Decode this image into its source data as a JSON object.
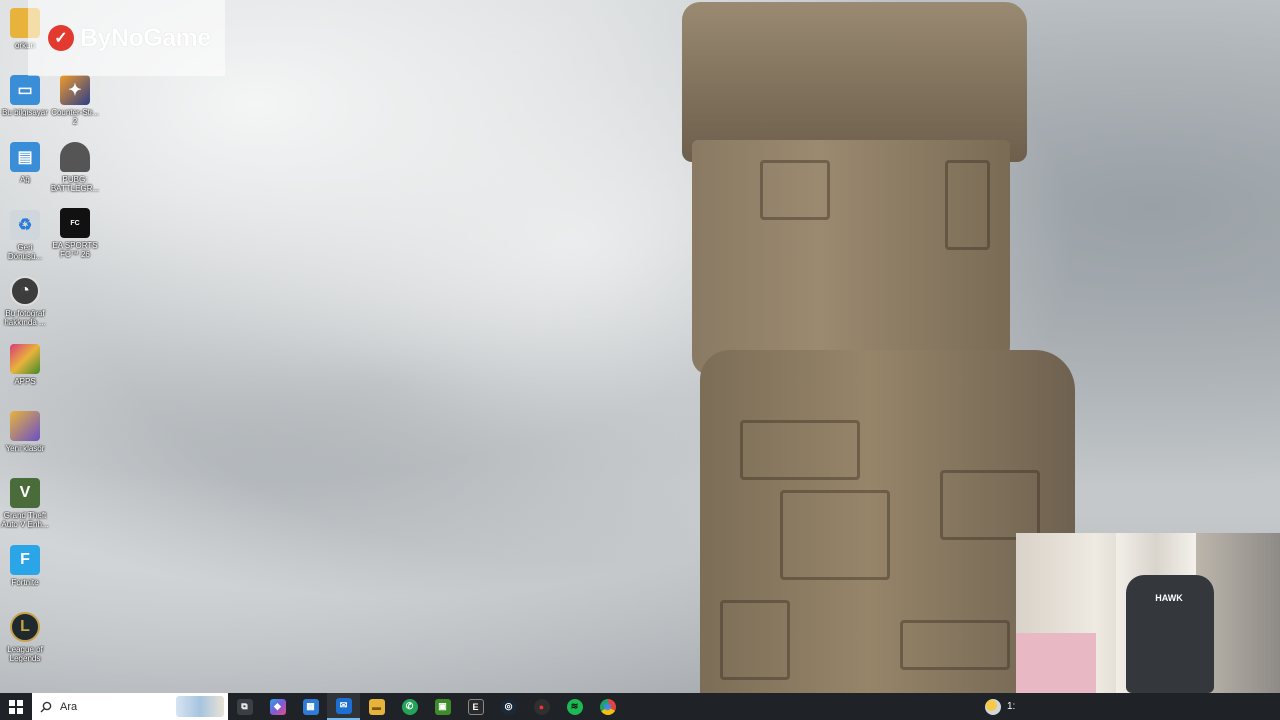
{
  "brand": {
    "logo_text": "ByNoGame",
    "logo_mark": "✓"
  },
  "desktop": {
    "icons": [
      {
        "id": "orkun",
        "label": "orkun",
        "icon": "folder-icon",
        "color": "#e8b33c"
      },
      {
        "id": "this-pc",
        "label": "Bu bilgisayar",
        "icon": "computer-icon",
        "color": "#3a8ed8"
      },
      {
        "id": "counter-strike",
        "label": "Counter-Str... 2",
        "icon": "cs2-icon",
        "color": "#f09a2a"
      },
      {
        "id": "network",
        "label": "Ağ",
        "icon": "network-icon",
        "color": "#3a8ed8"
      },
      {
        "id": "pubg",
        "label": "PUBG: BATTLEGR...",
        "icon": "pubg-helmet-icon",
        "color": "#555555"
      },
      {
        "id": "recycle-bin",
        "label": "Geri Dönüşü...",
        "icon": "recycle-bin-icon",
        "color": "#cfd6dc"
      },
      {
        "id": "ea-fc",
        "label": "EA SPORTS FC™ 26",
        "icon": "ea-fc-icon",
        "color": "#111111"
      },
      {
        "id": "about-photo",
        "label": "Bu fotoğraf hakkında ...",
        "icon": "camera-info-icon",
        "color": "#3c3c3c"
      },
      {
        "id": "apps",
        "label": "APPS",
        "icon": "apps-folder-icon",
        "color": "#d83a7c"
      },
      {
        "id": "new-folder",
        "label": "Yeni klasör",
        "icon": "folder-icon",
        "color": "#e8b33c"
      },
      {
        "id": "gta-v",
        "label": "Grand Theft Auto V Enh...",
        "icon": "gta-v-icon",
        "color": "#4a6b3a"
      },
      {
        "id": "fortnite",
        "label": "Fortnite",
        "icon": "fortnite-icon",
        "color": "#2aa6e8"
      },
      {
        "id": "league",
        "label": "League of Legends",
        "icon": "league-icon",
        "color": "#c8a24a"
      }
    ]
  },
  "taskbar": {
    "search_placeholder": "Ara",
    "apps": [
      {
        "name": "task-view",
        "icon": "task-view-icon",
        "glyph": "⧉",
        "color": "#3b3f46"
      },
      {
        "name": "copilot",
        "icon": "copilot-icon",
        "glyph": "◆",
        "color": "#7b5cd6"
      },
      {
        "name": "store",
        "icon": "store-icon",
        "glyph": "▦",
        "color": "#2e7bd6"
      },
      {
        "name": "outlook",
        "icon": "mail-icon",
        "glyph": "✉",
        "color": "#1d6fd1",
        "active": true
      },
      {
        "name": "file-explorer",
        "icon": "folder-icon",
        "glyph": "▬",
        "color": "#e8b33c"
      },
      {
        "name": "whatsapp",
        "icon": "whatsapp-icon",
        "glyph": "✆",
        "color": "#25a35a"
      },
      {
        "name": "minecraft",
        "icon": "minecraft-icon",
        "glyph": "▣",
        "color": "#3f8a2a"
      },
      {
        "name": "epic-games",
        "icon": "epic-games-icon",
        "glyph": "E",
        "color": "#2a2a2a"
      },
      {
        "name": "steam",
        "icon": "steam-icon",
        "glyph": "◎",
        "color": "#1b2838"
      },
      {
        "name": "obs",
        "icon": "record-icon",
        "glyph": "●",
        "color": "#2f2f2f"
      },
      {
        "name": "spotify",
        "icon": "spotify-icon",
        "glyph": "≋",
        "color": "#1db954"
      },
      {
        "name": "chrome",
        "icon": "chrome-icon",
        "glyph": "◉",
        "color": "#e3453a"
      }
    ],
    "clock": "1:"
  },
  "webcam": {
    "chair_brand": "HAWK"
  }
}
